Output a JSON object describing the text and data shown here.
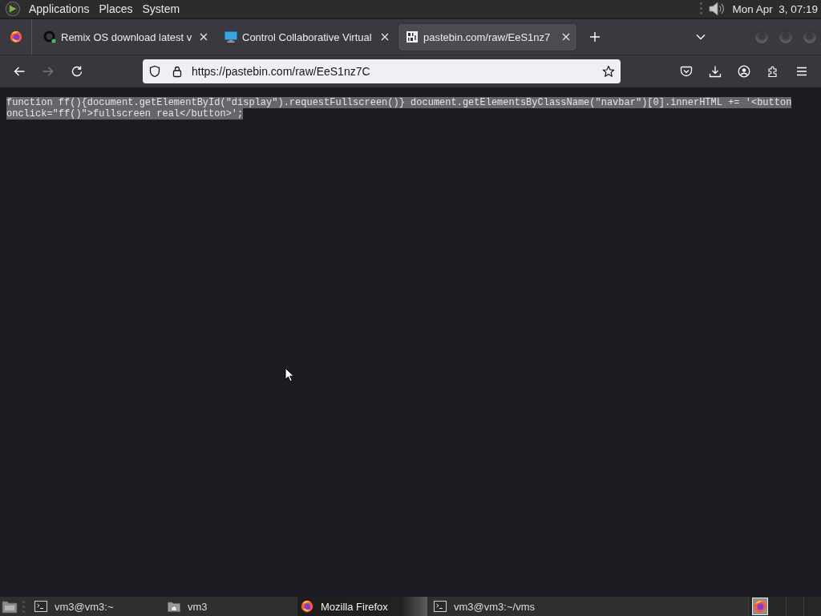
{
  "top_panel": {
    "menus": [
      "Applications",
      "Places",
      "System"
    ],
    "clock": "Mon Apr  3, 07:19"
  },
  "browser": {
    "tabs": [
      {
        "title": "Remix OS download latest v",
        "selected": false
      },
      {
        "title": "Control Collaborative Virtual",
        "selected": false
      },
      {
        "title": "pastebin.com/raw/EeS1nz7",
        "selected": true
      }
    ],
    "navigation": {
      "back_disabled": false,
      "forward_disabled": true
    },
    "address": "https://pastebin.com/raw/EeS1nz7C",
    "page": {
      "lines": [
        "function ff(){document.getElementById(\"display\").requestFullscreen()} document.getElementsByClassName(\"navbar\")[0].innerHTML += '<button",
        "onclick=\"ff()\">fullscreen real</button>';"
      ],
      "selected": true
    }
  },
  "taskbar": {
    "tasks": [
      {
        "kind": "terminal",
        "label": "vm3@vm3:~",
        "selected": false
      },
      {
        "kind": "folder",
        "label": "vm3",
        "selected": false
      },
      {
        "kind": "browser",
        "label": "Mozilla Firefox",
        "selected": true
      },
      {
        "kind": "terminal",
        "label": "vm3@vm3:~/vms",
        "selected": false
      }
    ]
  }
}
